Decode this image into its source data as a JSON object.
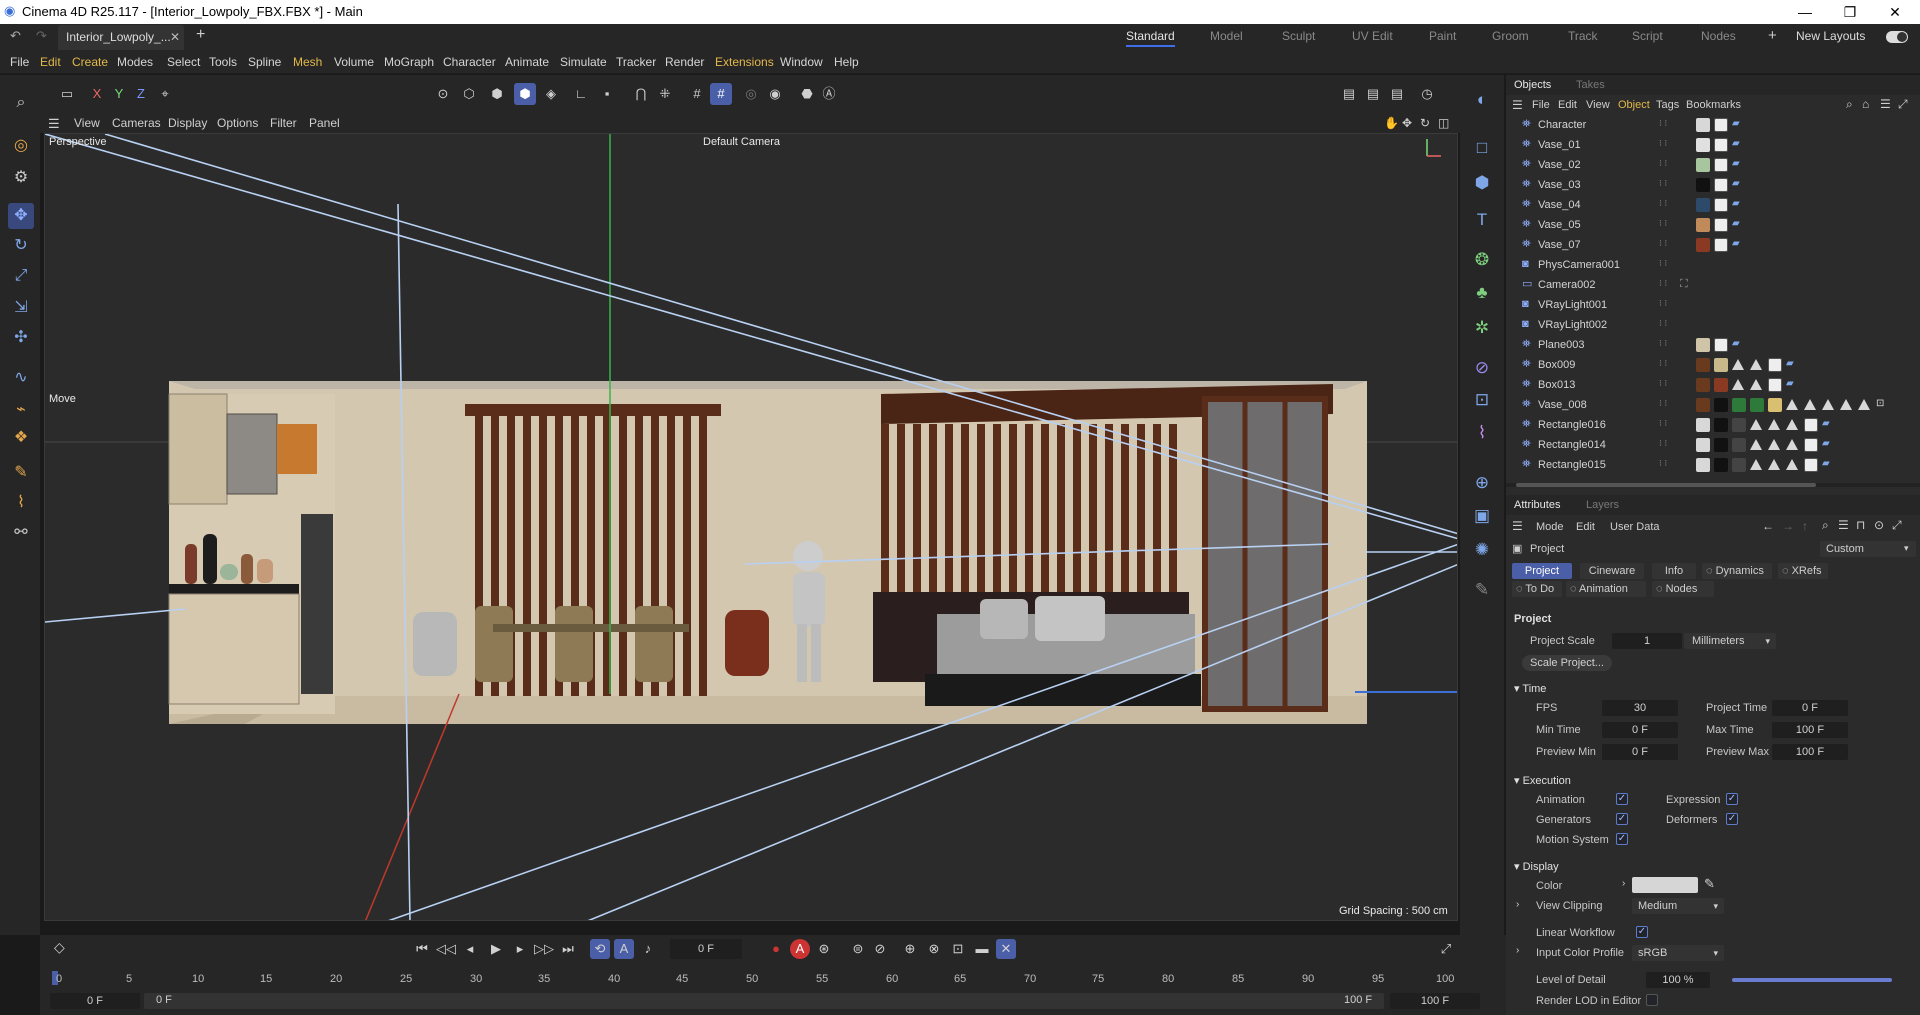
{
  "window": {
    "title": "Cinema 4D R25.117 - [Interior_Lowpoly_FBX.FBX *] - Main"
  },
  "tabs": {
    "doc_tab": "Interior_Lowpoly_...",
    "close": "✕",
    "add": "+"
  },
  "layouts": [
    "Standard",
    "Model",
    "Sculpt",
    "UV Edit",
    "Paint",
    "Groom",
    "Track",
    "Script",
    "Nodes"
  ],
  "new_layouts": "New Layouts",
  "menu": [
    "File",
    "Edit",
    "Create",
    "Modes",
    "Select",
    "Tools",
    "Spline",
    "Mesh",
    "Volume",
    "MoGraph",
    "Character",
    "Animate",
    "Simulate",
    "Tracker",
    "Render",
    "Extensions",
    "Window",
    "Help"
  ],
  "viewport_menu": [
    "View",
    "Cameras",
    "Display",
    "Options",
    "Filter",
    "Panel"
  ],
  "viewport": {
    "mode_label": "Perspective",
    "camera_label": "Default Camera",
    "move_label": "Move",
    "grid_spacing": "Grid Spacing : 500 cm"
  },
  "objects_panel": {
    "tabs": [
      "Objects",
      "Takes"
    ],
    "menu": [
      "File",
      "Edit",
      "View",
      "Object",
      "Tags",
      "Bookmarks"
    ],
    "items": [
      {
        "name": "Character"
      },
      {
        "name": "Vase_01"
      },
      {
        "name": "Vase_02"
      },
      {
        "name": "Vase_03"
      },
      {
        "name": "Vase_04"
      },
      {
        "name": "Vase_05"
      },
      {
        "name": "Vase_07"
      },
      {
        "name": "PhysCamera001"
      },
      {
        "name": "Camera002"
      },
      {
        "name": "VRayLight001"
      },
      {
        "name": "VRayLight002"
      },
      {
        "name": "Plane003"
      },
      {
        "name": "Box009"
      },
      {
        "name": "Box013"
      },
      {
        "name": "Vase_008"
      },
      {
        "name": "Rectangle016"
      },
      {
        "name": "Rectangle014"
      },
      {
        "name": "Rectangle015"
      }
    ]
  },
  "attributes_panel": {
    "tabs": [
      "Attributes",
      "Layers"
    ],
    "menu": [
      "Mode",
      "Edit",
      "User Data"
    ],
    "object": "Project",
    "preset": "Custom",
    "subtabs": [
      "Project",
      "Cineware",
      "Info",
      "Dynamics",
      "XRefs",
      "To Do",
      "Animation",
      "Nodes"
    ],
    "section_project": "Project",
    "project_scale_label": "Project Scale",
    "project_scale_value": "1",
    "project_scale_unit": "Millimeters",
    "scale_button": "Scale Project...",
    "time_section": "Time",
    "fps_label": "FPS",
    "fps_value": "30",
    "project_time_label": "Project Time",
    "project_time_value": "0 F",
    "min_time_label": "Min Time",
    "min_time_value": "0 F",
    "max_time_label": "Max Time",
    "max_time_value": "100 F",
    "preview_min_label": "Preview Min",
    "preview_min_value": "0 F",
    "preview_max_label": "Preview Max",
    "preview_max_value": "100 F",
    "execution_section": "Execution",
    "animation_label": "Animation",
    "expression_label": "Expression",
    "generators_label": "Generators",
    "deformers_label": "Deformers",
    "motion_system_label": "Motion System",
    "display_section": "Display",
    "color_label": "Color",
    "view_clipping_label": "View Clipping",
    "view_clipping_value": "Medium",
    "linear_workflow_label": "Linear Workflow",
    "input_color_profile_label": "Input Color Profile",
    "input_color_profile_value": "sRGB",
    "lod_label": "Level of Detail",
    "lod_value": "100 %",
    "lod_fraction": 1.0,
    "render_lod_label": "Render LOD in Editor"
  },
  "timeline": {
    "current_frame": "0 F",
    "ticks": [
      "0",
      "5",
      "10",
      "15",
      "20",
      "25",
      "30",
      "35",
      "40",
      "45",
      "50",
      "55",
      "60",
      "65",
      "70",
      "75",
      "80",
      "85",
      "90",
      "95",
      "100"
    ],
    "range_start": "0 F",
    "range_start2": "0 F",
    "range_end": "100 F",
    "range_end2": "100 F"
  },
  "colors": {
    "accent": "#4a5fa8",
    "bg": "#262626",
    "viewport_bg": "#2a2a2a"
  }
}
